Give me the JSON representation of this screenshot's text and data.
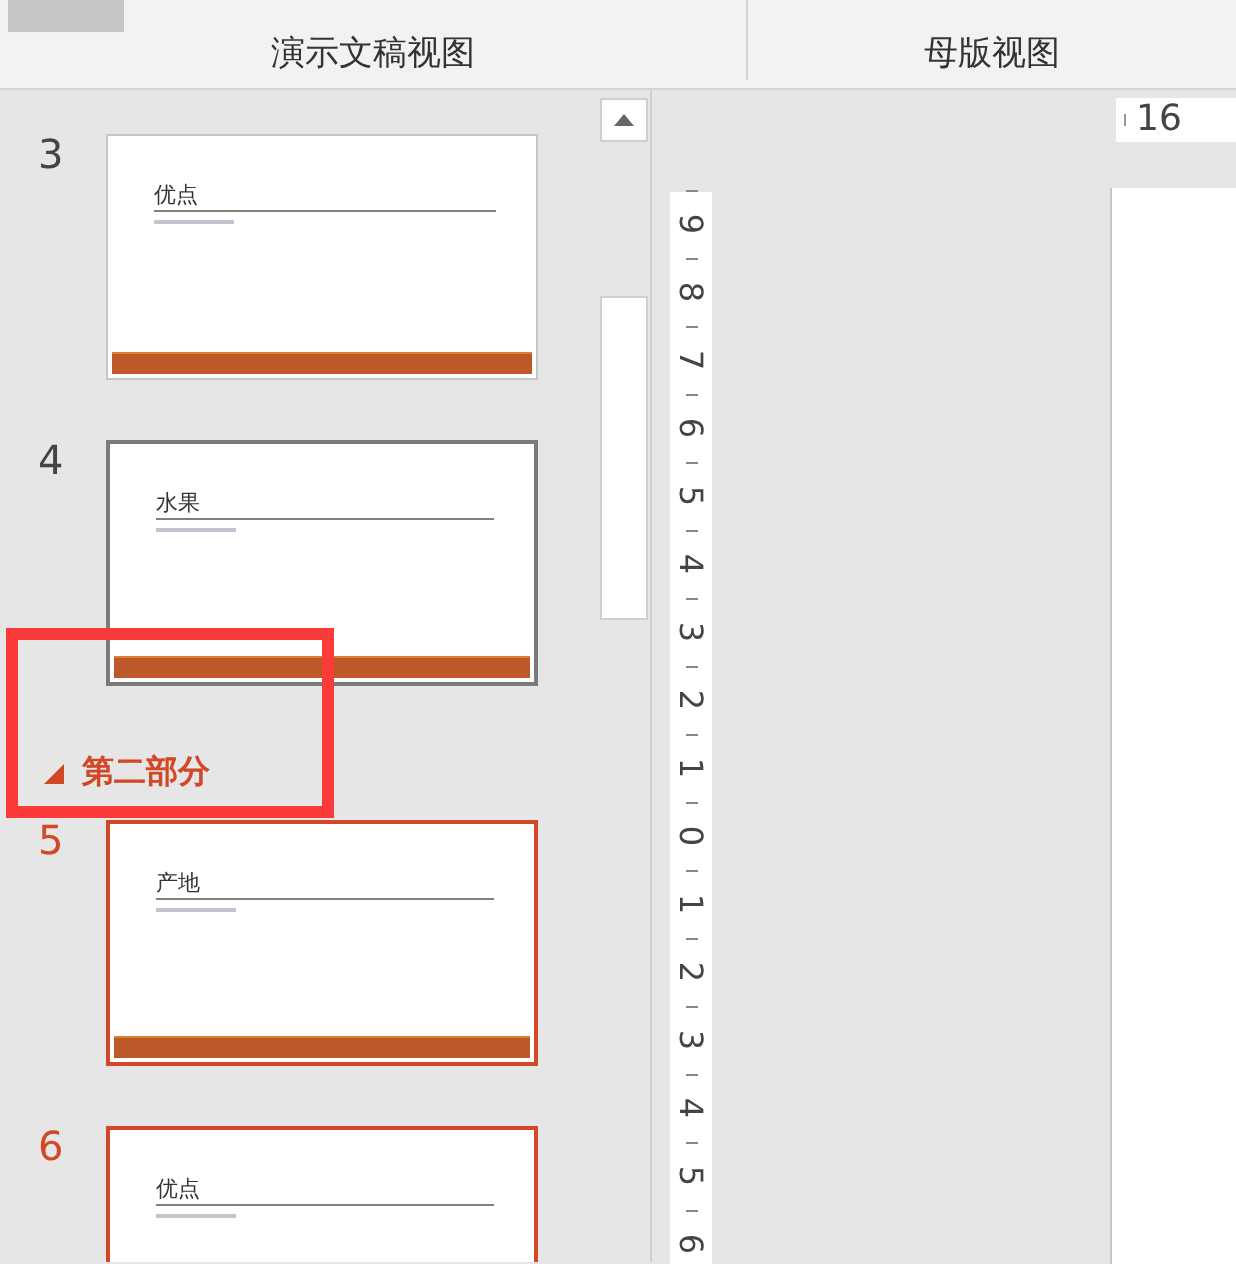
{
  "tabs": [
    {
      "label": "演示文稿视图"
    },
    {
      "label": "母版视图"
    }
  ],
  "slides": [
    {
      "kind": "slide",
      "number": "3",
      "title": "优点",
      "selected": false,
      "hovered": false
    },
    {
      "kind": "slide",
      "number": "4",
      "title": "水果",
      "selected": false,
      "hovered": true
    },
    {
      "kind": "section",
      "title": "第二部分",
      "expanded": true
    },
    {
      "kind": "slide",
      "number": "5",
      "title": "产地",
      "selected": true
    },
    {
      "kind": "slide",
      "number": "6",
      "title": "优点",
      "selected": true
    }
  ],
  "horizontal_ruler": [
    "16"
  ],
  "vertical_ruler": [
    "9",
    "8",
    "7",
    "6",
    "5",
    "4",
    "3",
    "2",
    "1",
    "0",
    "1",
    "2",
    "3",
    "4",
    "5",
    "6"
  ]
}
